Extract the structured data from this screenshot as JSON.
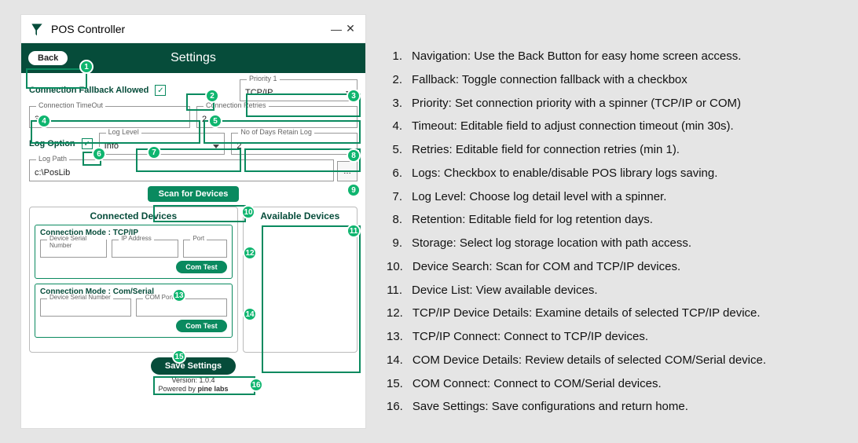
{
  "window": {
    "title": "POS Controller",
    "minimize": "—",
    "close": "✕"
  },
  "header": {
    "back": "Back",
    "title": "Settings"
  },
  "fallback": {
    "label": "Connection Fallback Allowed",
    "checked": "✓"
  },
  "priority": {
    "legend": "Priority 1",
    "value": "TCP/IP"
  },
  "timeout": {
    "legend": "Connection TimeOut",
    "value": "30"
  },
  "retries": {
    "legend": "Connection Retries",
    "value": "2"
  },
  "logopt": {
    "label": "Log Option",
    "checked": "✓"
  },
  "loglevel": {
    "legend": "Log Level",
    "value": "Info"
  },
  "retain": {
    "legend": "No of Days Retain Log",
    "value": "2"
  },
  "logpath": {
    "legend": "Log Path",
    "value": "c:\\PosLib",
    "browse": "…"
  },
  "scan": "Scan for Devices",
  "panels": {
    "connected": "Connected Devices",
    "available": "Available Devices"
  },
  "device_tcp": {
    "mode": "Connection Mode : TCP/IP",
    "serial_legend": "Device Serial Number",
    "ip_legend": "IP Address",
    "port_legend": "Port",
    "btn": "Com Test"
  },
  "device_com": {
    "mode": "Connection Mode : Com/Serial",
    "serial_legend": "Device Serial Number",
    "port_legend": "COM Port",
    "btn": "Com Test"
  },
  "save": "Save Settings",
  "footer": {
    "version": "Version: 1.0.4",
    "powered": "Powered by",
    "vendor": "pine labs"
  },
  "notes": [
    "Navigation: Use the Back Button for easy home screen access.",
    "Fallback: Toggle connection fallback with a checkbox",
    "Priority: Set connection priority with a spinner (TCP/IP or COM)",
    "Timeout: Editable field to adjust connection timeout (min 30s).",
    "Retries: Editable field for connection retries (min 1).",
    "Logs: Checkbox to enable/disable POS library logs saving.",
    "Log Level: Choose log detail level with a spinner.",
    "Retention: Editable field for log retention days.",
    "Storage: Select log storage location with path access.",
    "Device Search: Scan for COM and TCP/IP devices.",
    "Device List: View available devices.",
    "TCP/IP Device Details: Examine details of selected TCP/IP device.",
    "TCP/IP Connect: Connect to TCP/IP devices.",
    "COM Device Details: Review details of selected COM/Serial device.",
    "COM Connect: Connect to COM/Serial devices.",
    "Save Settings: Save configurations and return home."
  ]
}
